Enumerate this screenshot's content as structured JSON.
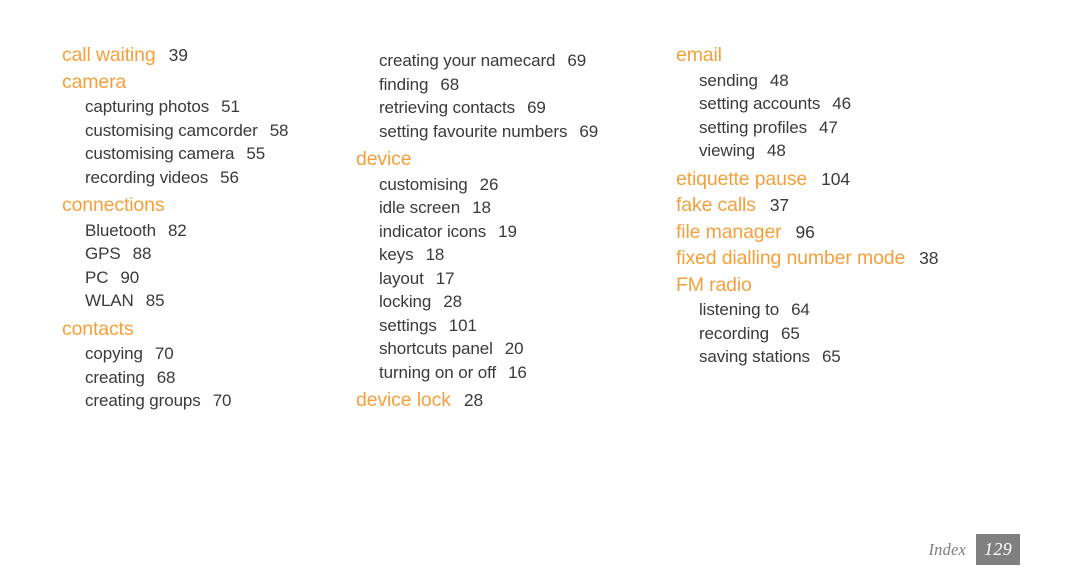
{
  "document": {
    "type": "index-page",
    "footer": {
      "label": "Index",
      "page_number": "129"
    },
    "colors": {
      "heading": "#f5a03c",
      "body_text": "#3a3a3a",
      "footer_text": "#7d7d7d",
      "footer_box": "#808080",
      "background": "#ffffff"
    }
  },
  "columns": [
    {
      "id": "column-1",
      "groups": [
        {
          "term": "call waiting",
          "page": "39",
          "subitems": []
        },
        {
          "term": "camera",
          "page": "",
          "subitems": [
            {
              "term": "capturing photos",
              "page": "51"
            },
            {
              "term": "customising camcorder",
              "page": "58"
            },
            {
              "term": "customising camera",
              "page": "55"
            },
            {
              "term": "recording videos",
              "page": "56"
            }
          ]
        },
        {
          "term": "connections",
          "page": "",
          "subitems": [
            {
              "term": "Bluetooth",
              "page": "82"
            },
            {
              "term": "GPS",
              "page": "88"
            },
            {
              "term": "PC",
              "page": "90"
            },
            {
              "term": "WLAN",
              "page": "85"
            }
          ]
        },
        {
          "term": "contacts",
          "page": "",
          "subitems": [
            {
              "term": "copying",
              "page": "70"
            },
            {
              "term": "creating",
              "page": "68"
            },
            {
              "term": "creating groups",
              "page": "70"
            }
          ]
        }
      ]
    },
    {
      "id": "column-2",
      "groups": [
        {
          "term": "",
          "page": "",
          "subitems": [
            {
              "term": "creating your namecard",
              "page": "69"
            },
            {
              "term": "finding",
              "page": "68"
            },
            {
              "term": "retrieving contacts",
              "page": "69"
            },
            {
              "term": "setting favourite numbers",
              "page": "69"
            }
          ]
        },
        {
          "term": "device",
          "page": "",
          "subitems": [
            {
              "term": "customising",
              "page": "26"
            },
            {
              "term": "idle screen",
              "page": "18"
            },
            {
              "term": "indicator icons",
              "page": "19"
            },
            {
              "term": "keys",
              "page": "18"
            },
            {
              "term": "layout",
              "page": "17"
            },
            {
              "term": "locking",
              "page": "28"
            },
            {
              "term": "settings",
              "page": "101"
            },
            {
              "term": "shortcuts panel",
              "page": "20"
            },
            {
              "term": "turning on or off",
              "page": "16"
            }
          ]
        },
        {
          "term": "device lock",
          "page": "28",
          "subitems": []
        }
      ]
    },
    {
      "id": "column-3",
      "groups": [
        {
          "term": "email",
          "page": "",
          "subitems": [
            {
              "term": "sending",
              "page": "48"
            },
            {
              "term": "setting accounts",
              "page": "46"
            },
            {
              "term": "setting profiles",
              "page": "47"
            },
            {
              "term": "viewing",
              "page": "48"
            }
          ]
        },
        {
          "term": "etiquette pause",
          "page": "104",
          "subitems": []
        },
        {
          "term": "fake calls",
          "page": "37",
          "subitems": []
        },
        {
          "term": "file manager",
          "page": "96",
          "subitems": []
        },
        {
          "term": "fixed dialling number mode",
          "page": "38",
          "subitems": []
        },
        {
          "term": "FM radio",
          "page": "",
          "subitems": [
            {
              "term": "listening to",
              "page": "64"
            },
            {
              "term": "recording",
              "page": "65"
            },
            {
              "term": "saving stations",
              "page": "65"
            }
          ]
        }
      ]
    }
  ]
}
